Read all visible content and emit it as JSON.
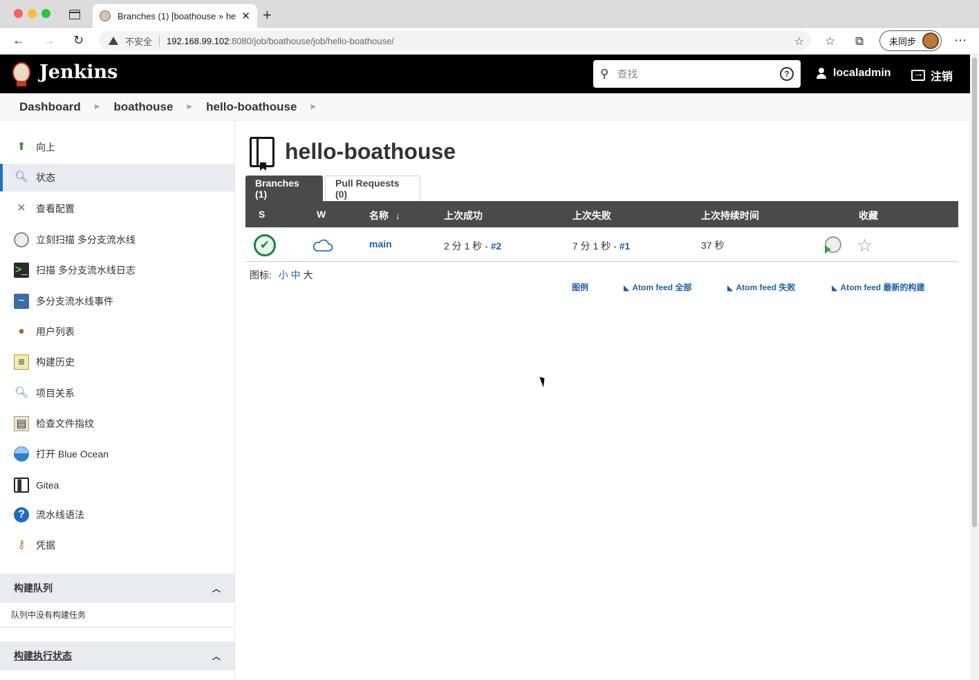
{
  "browser": {
    "tab_title": "Branches (1) [boathouse » hell",
    "url_insecure_label": "不安全",
    "url_host": "192.168.99.102",
    "url_rest": ":8080/job/boathouse/job/hello-boathouse/",
    "profile_label": "未同步"
  },
  "header": {
    "app_name": "Jenkins",
    "search_placeholder": "查找",
    "user_name": "localadmin",
    "logout_label": "注销"
  },
  "breadcrumb": [
    "Dashboard",
    "boathouse",
    "hello-boathouse"
  ],
  "sidebar": {
    "items": [
      {
        "label": "向上",
        "icon": "up-arrow-icon"
      },
      {
        "label": "状态",
        "icon": "search-icon"
      },
      {
        "label": "查看配置",
        "icon": "tools-icon"
      },
      {
        "label": "立刻扫描 多分支流水线",
        "icon": "clock-icon"
      },
      {
        "label": "扫描 多分支流水线日志",
        "icon": "terminal-icon"
      },
      {
        "label": "多分支流水线事件",
        "icon": "monitor-icon"
      },
      {
        "label": "用户列表",
        "icon": "users-icon"
      },
      {
        "label": "构建历史",
        "icon": "notepad-icon"
      },
      {
        "label": "项目关系",
        "icon": "search-icon"
      },
      {
        "label": "检查文件指纹",
        "icon": "fingerprint-icon"
      },
      {
        "label": "打开 Blue Ocean",
        "icon": "blue-ocean-icon"
      },
      {
        "label": "Gitea",
        "icon": "book-icon"
      },
      {
        "label": "流水线语法",
        "icon": "help-icon"
      },
      {
        "label": "凭据",
        "icon": "keys-icon"
      }
    ],
    "build_queue_title": "构建队列",
    "build_queue_empty": "队列中没有构建任务",
    "executor_title": "构建执行状态"
  },
  "main": {
    "title": "hello-boathouse",
    "tabs": [
      "Branches (1)",
      "Pull Requests (0)"
    ],
    "columns": [
      "S",
      "W",
      "名称",
      "上次成功",
      "上次失败",
      "上次持续时间",
      "收藏"
    ],
    "sort_indicator": "↓",
    "rows": [
      {
        "name": "main",
        "last_success": "2 分 1 秒 -",
        "last_success_build": "#2",
        "last_failure": "7 分 1 秒 -",
        "last_failure_build": "#1",
        "last_duration": "37 秒"
      }
    ],
    "icon_size_label": "图标:",
    "icon_sizes": [
      "小",
      "中",
      "大"
    ],
    "footer_links": [
      "图例",
      "Atom feed 全部",
      "Atom feed 失败",
      "Atom feed 最新的构建"
    ]
  }
}
